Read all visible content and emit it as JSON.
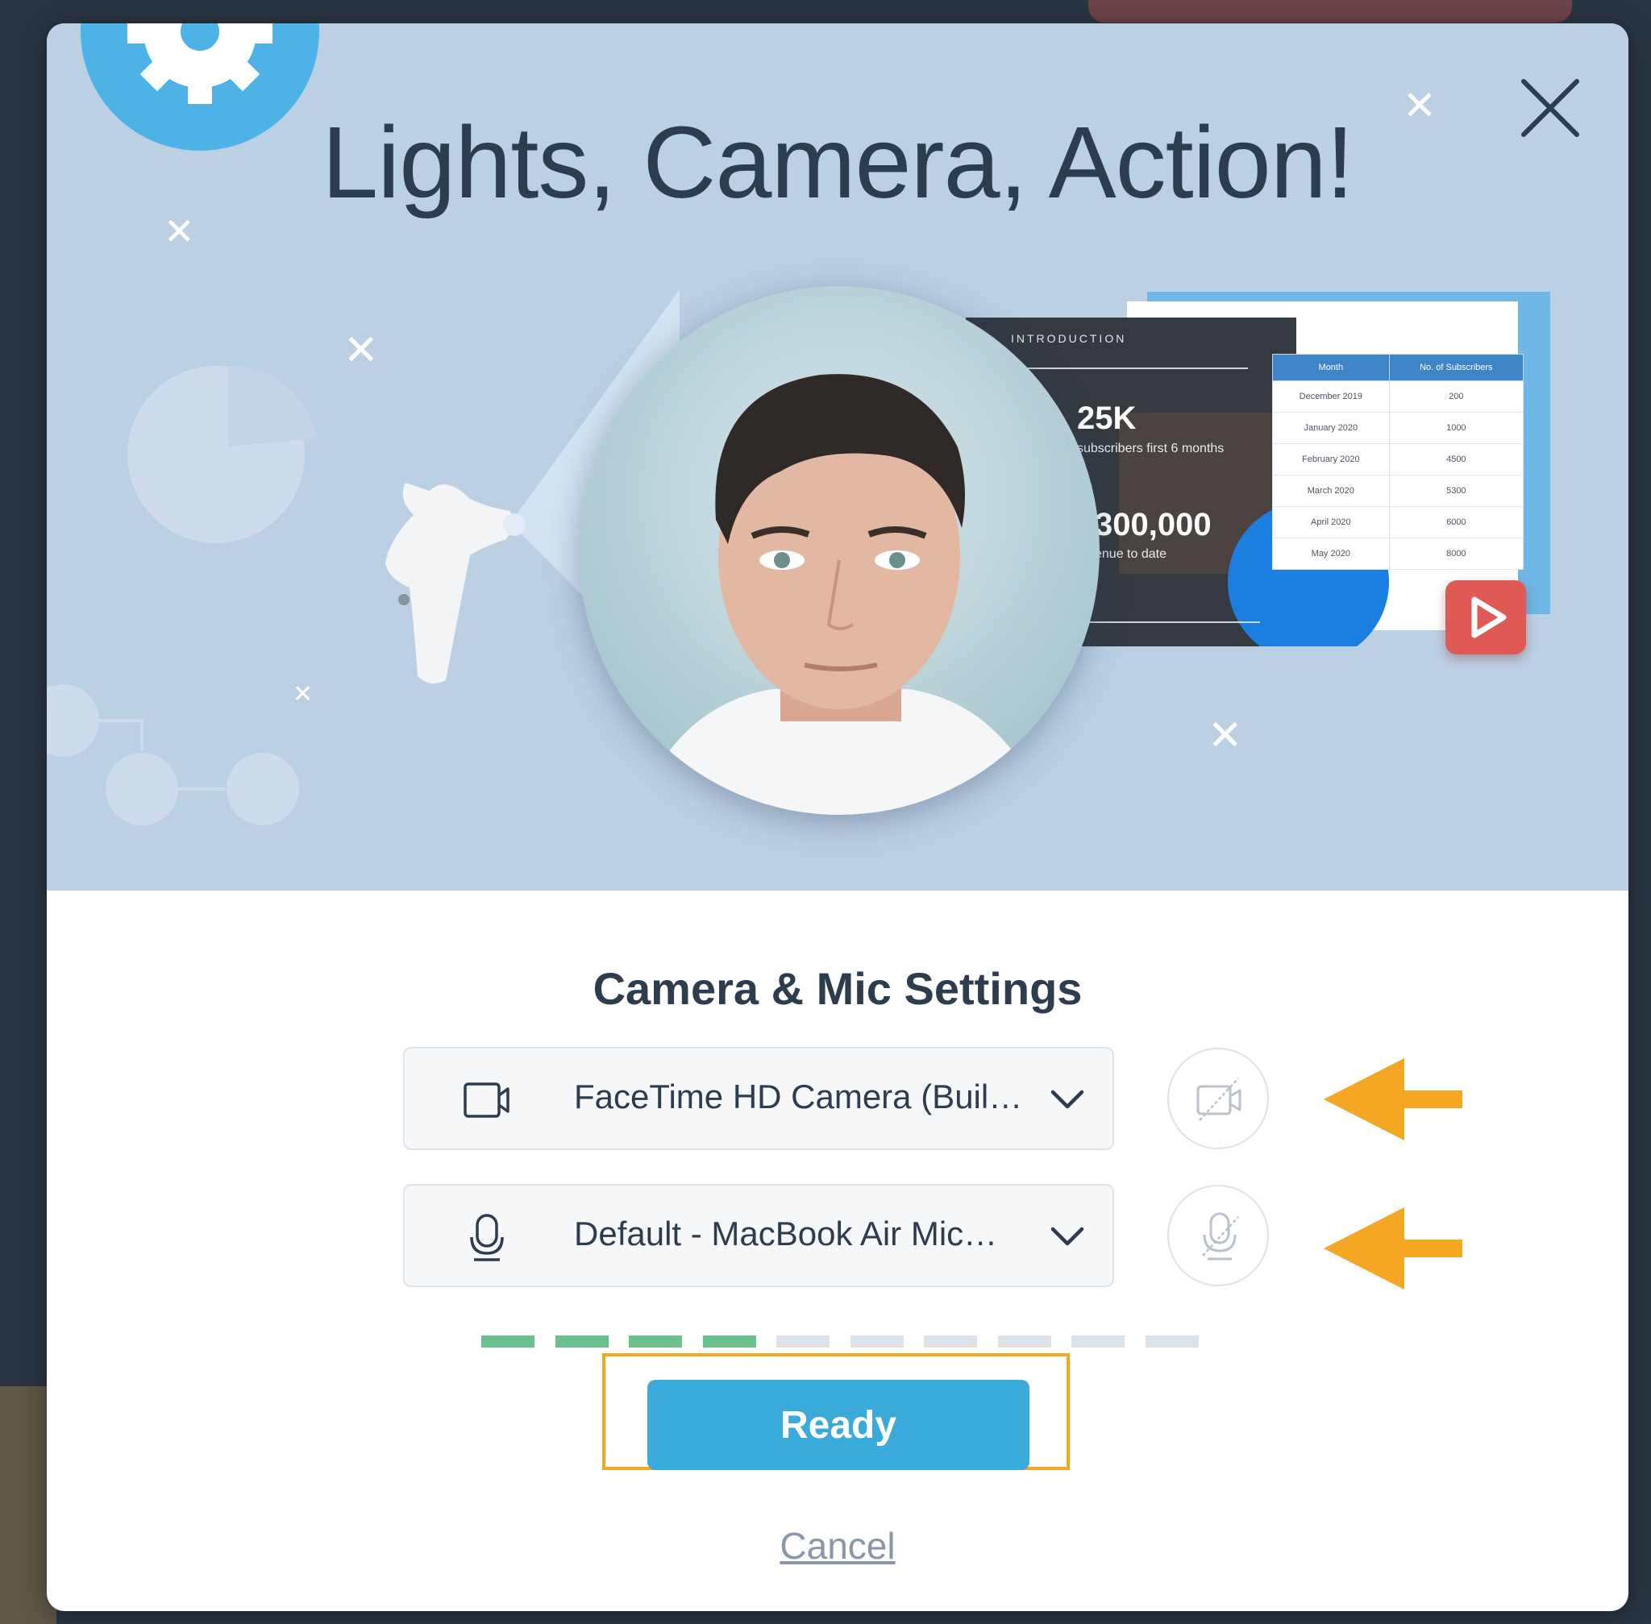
{
  "hero": {
    "title": "Lights, Camera, Action!",
    "slide": {
      "label": "INTRODUCTION",
      "stat1": "25K",
      "stat1_sub": "subscribers first 6 months",
      "stat2": "300,000",
      "stat2_sub": "enue to date",
      "table_headers": [
        "Month",
        "No. of Subscribers"
      ],
      "table_rows": [
        [
          "December 2019",
          "200"
        ],
        [
          "January 2020",
          "1000"
        ],
        [
          "February 2020",
          "4500"
        ],
        [
          "March 2020",
          "5300"
        ],
        [
          "April 2020",
          "6000"
        ],
        [
          "May 2020",
          "8000"
        ]
      ]
    }
  },
  "settings": {
    "title": "Camera & Mic Settings",
    "camera": {
      "selected": "FaceTime HD Camera (Buil…",
      "icon": "video-camera-icon",
      "toggle_icon": "camera-off-icon"
    },
    "mic": {
      "selected": "Default - MacBook Air Mic…",
      "icon": "microphone-icon",
      "toggle_icon": "microphone-off-icon"
    },
    "audio_level": {
      "active_bars": 4,
      "total_bars": 10
    },
    "ready_label": "Ready",
    "cancel_label": "Cancel"
  },
  "colors": {
    "hero_bg": "#bcd0e4",
    "title_text": "#2d3d4f",
    "ready_button": "#3aabd8",
    "highlight_orange": "#f5a623",
    "level_active": "#6cc28e",
    "level_inactive": "#dde3e8"
  }
}
